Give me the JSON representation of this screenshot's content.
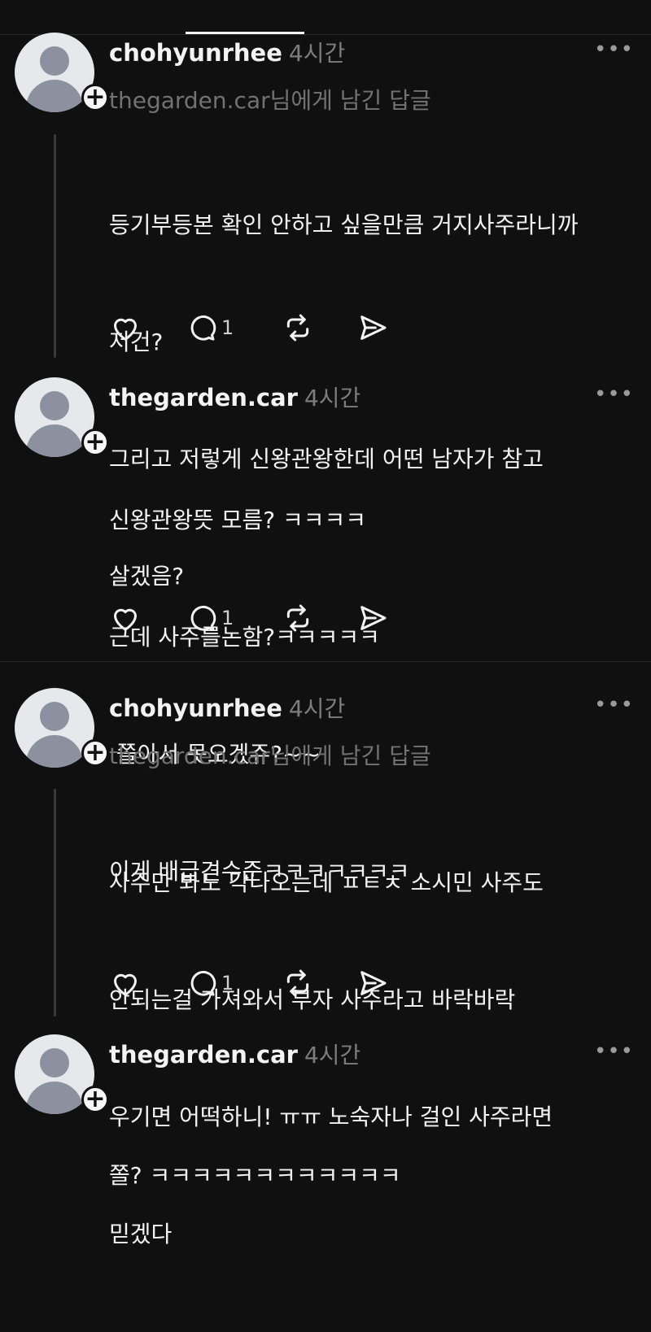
{
  "posts": [
    {
      "username": "chohyunrhee",
      "time": "4시간",
      "reply_to": "thegarden.car님에게 남긴 답글",
      "lines": [
        "등기부등본 확인 안하고 싶을만큼 거지사주라니까",
        "저건?",
        "그리고 저렇게 신왕관왕한데 어떤 남자가 참고",
        "살겠음?"
      ],
      "reply_count": "1"
    },
    {
      "username": "thegarden.car",
      "time": "4시간",
      "lines": [
        "신왕관왕뜻 모름? ㅋㅋㅋㅋ",
        "근데 사주를논함?ㅋㅋㅋㅋㅋ",
        " 쫄아서 못오겠쥬?~~",
        "이게 배급견수준ㅋㅋㅋㅋㅋㅋㅋ"
      ],
      "reply_count": "1"
    },
    {
      "username": "chohyunrhee",
      "time": "4시간",
      "reply_to": "thegarden.car님에게 남긴 답글",
      "lines": [
        "사주만 봐도 각나오는데 ㅍㅌㅊ 소시민 사주도",
        "안되는걸 가져와서 부자 사주라고 바락바락",
        "우기면 어떡하니! ㅠㅠ 노숙자나 걸인 사주라면",
        "믿겠다"
      ],
      "reply_count": "1"
    },
    {
      "username": "thegarden.car",
      "time": "4시간",
      "lines": [
        "쫄? ㅋㅋㅋㅋㅋㅋㅋㅋㅋㅋㅋㅋ"
      ]
    }
  ],
  "more_label": "•••",
  "plus_label": "+",
  "icons": {
    "like": "heart-icon",
    "comment": "comment-icon",
    "repost": "repost-icon",
    "share": "share-icon"
  }
}
